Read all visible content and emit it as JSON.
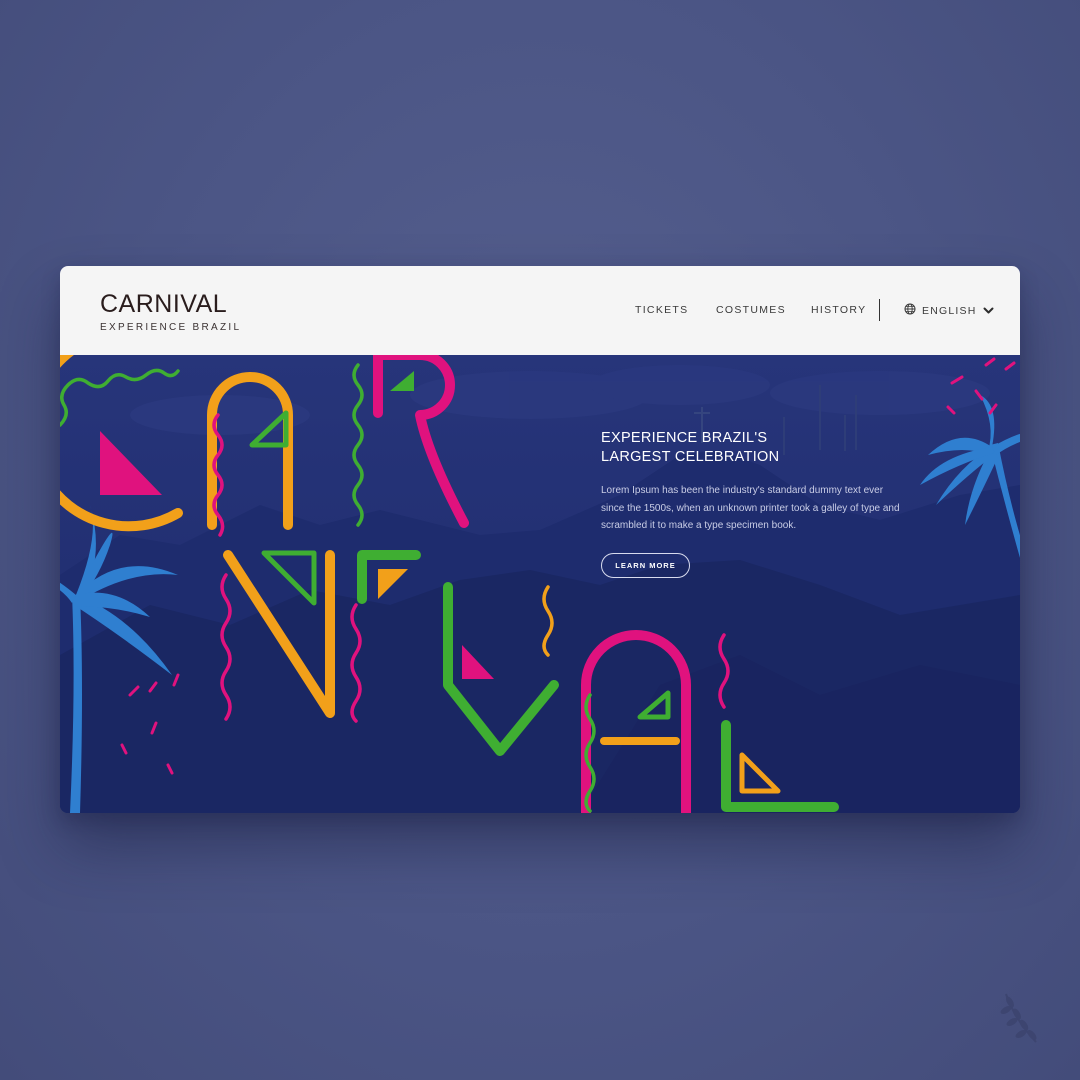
{
  "brand": {
    "title": "CARNIVAL",
    "subtitle": "EXPERIENCE BRAZIL"
  },
  "nav": {
    "items": [
      {
        "label": "TICKETS"
      },
      {
        "label": "COSTUMES"
      },
      {
        "label": "HISTORY"
      }
    ],
    "language": {
      "label": "ENGLISH",
      "icon": "globe-icon",
      "caret": "chevron-down-icon"
    }
  },
  "hero": {
    "heading_line1": "EXPERIENCE BRAZIL'S",
    "heading_line2": "LARGEST CELEBRATION",
    "body": "Lorem Ipsum has been the industry's standard dummy text ever since the 1500s, when an unknown printer took a galley of type and scrambled it to make a type specimen book.",
    "cta_label": "LEARN MORE"
  },
  "colors": {
    "navy_overlay": "#1c2a6c",
    "orange": "#f2a01a",
    "magenta": "#e0127e",
    "green": "#3fae32",
    "palm_blue": "#2f7fd0",
    "page_background": "#4f5a8a"
  },
  "decor": {
    "laurel_icon": "laurel-icon"
  }
}
